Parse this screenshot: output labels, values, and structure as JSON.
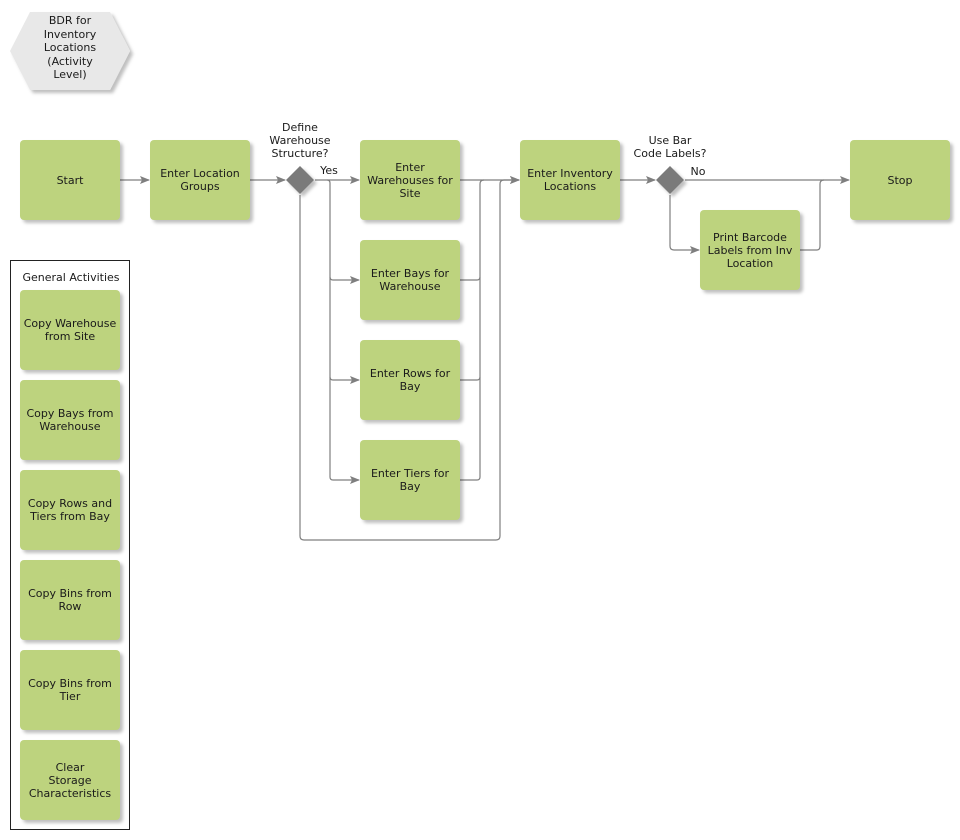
{
  "title": "BDR for\nInventory\nLocations\n(Activity\nLevel)",
  "colors": {
    "activity_fill": "#bdd37e",
    "gateway_fill": "#7a7a7a",
    "connector": "#7f7f7f",
    "title_fill": "#e8e8e8"
  },
  "activities": {
    "start": "Start",
    "enter_location_groups": "Enter Location\nGroups",
    "enter_warehouses": "Enter\nWarehouses for\nSite",
    "enter_bays": "Enter Bays for\nWarehouse",
    "enter_rows": "Enter Rows for\nBay",
    "enter_tiers": "Enter Tiers for\nBay",
    "enter_inventory_locations": "Enter Inventory\nLocations",
    "print_barcode": "Print Barcode\nLabels from Inv\nLocation",
    "stop": "Stop"
  },
  "gateways": {
    "define_structure": {
      "question": "Define\nWarehouse\nStructure?",
      "branch_label": "Yes"
    },
    "use_barcode": {
      "question": "Use Bar\nCode Labels?",
      "branch_label": "No"
    }
  },
  "general_activities": {
    "title": "General Activities",
    "items": [
      "Copy Warehouse\nfrom Site",
      "Copy Bays from\nWarehouse",
      "Copy Rows and\nTiers from Bay",
      "Copy Bins from\nRow",
      "Copy Bins from\nTier",
      "Clear\nStorage\nCharacteristics"
    ]
  }
}
